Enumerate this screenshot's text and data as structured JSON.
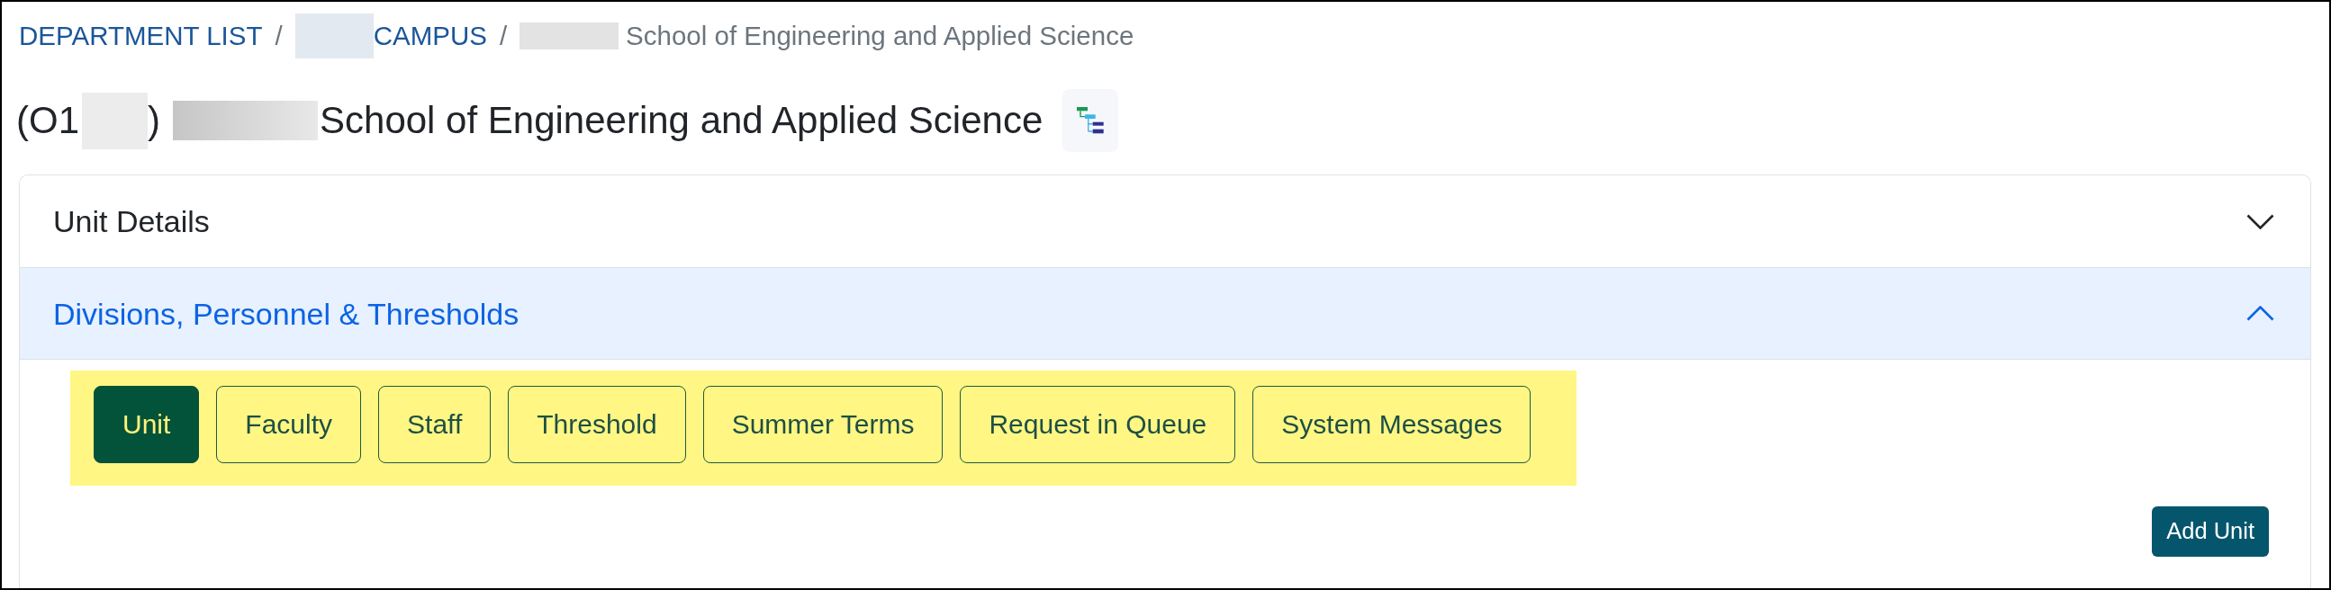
{
  "breadcrumb": [
    {
      "kind": "link",
      "label": "DEPARTMENT LIST"
    },
    {
      "kind": "separator",
      "label": "/"
    },
    {
      "kind": "redaction"
    },
    {
      "kind": "link",
      "label": "CAMPUS"
    },
    {
      "kind": "separator",
      "label": "/"
    },
    {
      "kind": "redaction"
    },
    {
      "kind": "current",
      "label": "School of Engineering and Applied Science"
    }
  ],
  "page_title": {
    "parts": [
      {
        "kind": "text",
        "text": "(O1"
      },
      {
        "kind": "redaction"
      },
      {
        "kind": "text",
        "text": ")"
      },
      {
        "kind": "redaction"
      },
      {
        "kind": "text",
        "text": "School of Engineering and Applied Science"
      }
    ]
  },
  "accordion": [
    {
      "title": "Unit Details",
      "expanded": false
    },
    {
      "title": "Divisions, Personnel & Thresholds",
      "expanded": true,
      "tab_bar": {
        "highlighted": true,
        "tabs": [
          {
            "label": "Unit",
            "selected": true
          },
          {
            "label": "Faculty",
            "selected": false
          },
          {
            "label": "Staff",
            "selected": false
          },
          {
            "label": "Threshold",
            "selected": false
          },
          {
            "label": "Summer Terms",
            "selected": false
          },
          {
            "label": "Request in Queue",
            "selected": false
          },
          {
            "label": "System Messages",
            "selected": false
          }
        ]
      },
      "actions": [
        {
          "label": "Add Unit"
        }
      ]
    }
  ]
}
